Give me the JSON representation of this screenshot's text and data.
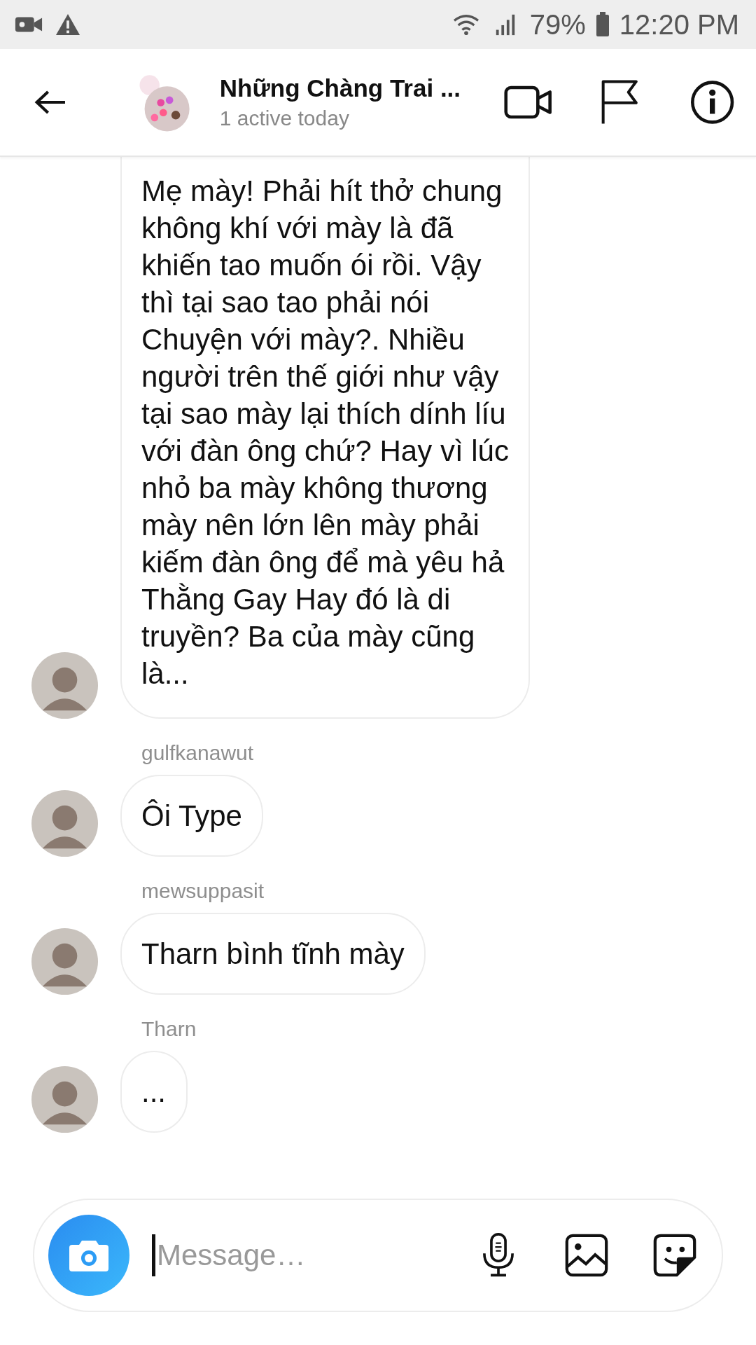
{
  "status_bar": {
    "battery": "79%",
    "time": "12:20 PM"
  },
  "header": {
    "title": "Những Chàng Trai ...",
    "subtitle": "1 active today"
  },
  "messages": [
    {
      "text": "Mẹ mày! Phải hít thở chung không khí với mày là đã khiến tao muốn ói rồi. Vậy thì tại sao tao phải nói Chuyện với mày?. Nhiều người trên thế giới như vậy tại sao mày lại thích dính líu với đàn ông chứ? Hay vì lúc nhỏ ba mày không thương mày nên lớn lên mày phải kiếm đàn ông để mà yêu hả Thằng Gay Hay đó là di truyền? Ba của mày cũng là..."
    },
    {
      "sender": "gulfkanawut",
      "text": "Ôi Type"
    },
    {
      "sender": "mewsuppasit",
      "text": "Tharn bình tĩnh mày"
    },
    {
      "sender": "Tharn",
      "text": "..."
    }
  ],
  "composer": {
    "placeholder": "Message…"
  }
}
